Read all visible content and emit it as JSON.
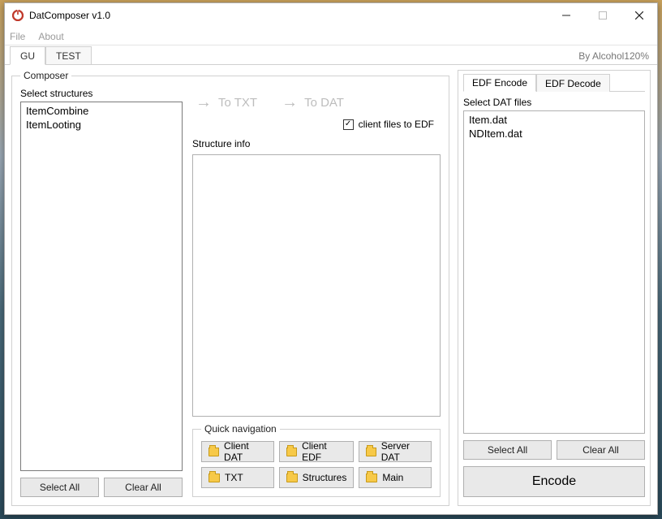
{
  "window": {
    "title": "DatComposer v1.0",
    "menu": {
      "file": "File",
      "about": "About"
    }
  },
  "tabs": {
    "items": [
      {
        "label": "GU",
        "active": true
      },
      {
        "label": "TEST",
        "active": false
      }
    ],
    "byline": "By Alcohol120%"
  },
  "composer": {
    "legend": "Composer",
    "select_structures_label": "Select structures",
    "structures": [
      "ItemCombine",
      "ItemLooting"
    ],
    "select_all": "Select All",
    "clear_all": "Clear All",
    "to_txt": "To TXT",
    "to_dat": "To DAT",
    "client_files_checkbox": "client files to EDF",
    "client_files_checked": true,
    "structure_info_label": "Structure info"
  },
  "quicknav": {
    "legend": "Quick navigation",
    "buttons": [
      "Client DAT",
      "Client EDF",
      "Server DAT",
      "TXT",
      "Structures",
      "Main"
    ]
  },
  "right": {
    "tabs": [
      {
        "label": "EDF Encode",
        "active": true
      },
      {
        "label": "EDF Decode",
        "active": false
      }
    ],
    "select_dat_label": "Select DAT files",
    "dat_files": [
      "Item.dat",
      "NDItem.dat"
    ],
    "select_all": "Select All",
    "clear_all": "Clear All",
    "encode": "Encode"
  }
}
